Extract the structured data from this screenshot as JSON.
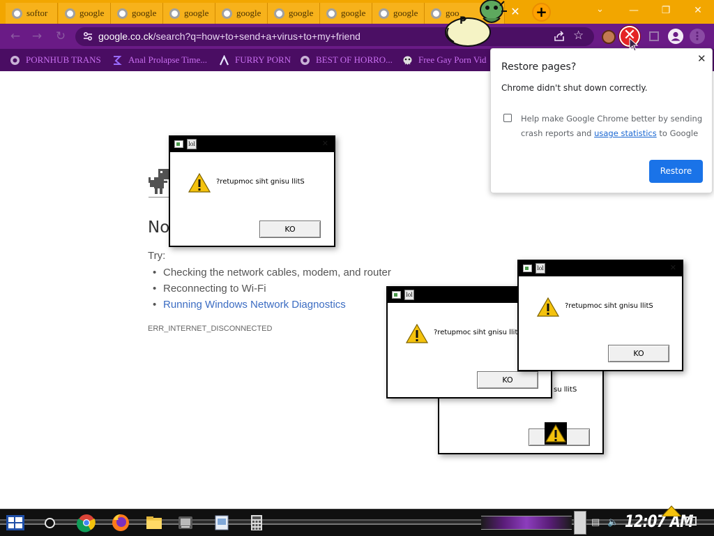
{
  "browser": {
    "tabs": [
      {
        "label": "softor"
      },
      {
        "label": "google"
      },
      {
        "label": "google"
      },
      {
        "label": "google"
      },
      {
        "label": "google"
      },
      {
        "label": "google"
      },
      {
        "label": "google"
      },
      {
        "label": "google"
      },
      {
        "label": "goo"
      }
    ],
    "close_tab_glyph": "✕",
    "new_tab_glyph": "+",
    "window_controls": {
      "minimize": "—",
      "restore": "❐",
      "close": "✕"
    },
    "url_host": "google.co.ck",
    "url_path": "/search?q=how+to+send+a+virus+to+my+friend",
    "toolbar_x_glyph": "✕",
    "accent_color": "#6a1b86",
    "tab_color": "#f2a600"
  },
  "bookmarks": [
    {
      "label": "PORNHUB TRANS",
      "icon": "globe-icon"
    },
    {
      "label": "Anal Prolapse Time...",
      "icon": "bracket-icon"
    },
    {
      "label": "FURRY PORN",
      "icon": "lambda-icon"
    },
    {
      "label": "BEST OF HORRO...",
      "icon": "globe-icon"
    },
    {
      "label": "Free Gay Porn Vid",
      "icon": "mask-icon"
    }
  ],
  "error_page": {
    "title": "No",
    "try_label": "Try:",
    "suggestions": [
      "Checking the network cables, modem, and router",
      "Reconnecting to Wi-Fi",
      "Running Windows Network Diagnostics"
    ],
    "error_code": "ERR_INTERNET_DISCONNECTED"
  },
  "dialogs": [
    {
      "message": "?retupmoc siht gnisu llitS",
      "ok": "KO",
      "title_icon_text": "lol"
    },
    {
      "message": "su llitS",
      "ok": "",
      "title_icon_text": ""
    },
    {
      "message": "?retupmoc siht gnisu llit",
      "ok": "KO",
      "title_icon_text": "lol"
    },
    {
      "message": "?retupmoc siht gnisu llitS",
      "ok": "KO",
      "title_icon_text": "lol"
    }
  ],
  "restore_popup": {
    "title": "Restore pages?",
    "subtitle": "Chrome didn't shut down correctly.",
    "checkbox_text_before": "Help make Google Chrome better by sending crash reports and ",
    "checkbox_link": "usage statistics",
    "checkbox_text_after": " to Google",
    "button": "Restore",
    "close_glyph": "✕"
  },
  "taskbar": {
    "clock": "12:07 AM",
    "tray_icons": [
      "network-icon",
      "volume-icon"
    ]
  }
}
